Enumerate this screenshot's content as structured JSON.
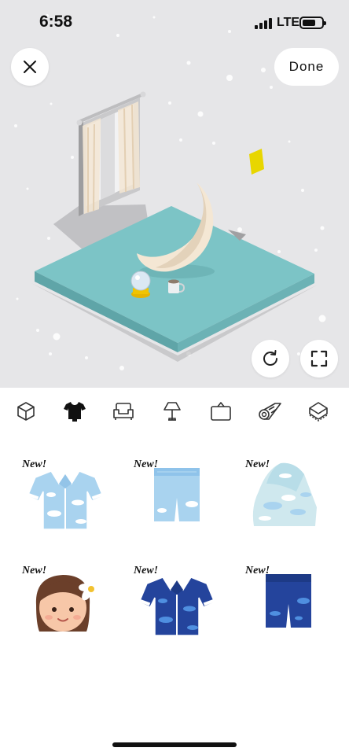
{
  "status": {
    "time": "6:58",
    "network": "LTE"
  },
  "toolbar": {
    "done_label": "Done"
  },
  "categories": [
    {
      "icon": "cube-icon",
      "selected": false
    },
    {
      "icon": "tshirt-icon",
      "selected": true
    },
    {
      "icon": "sofa-icon",
      "selected": false
    },
    {
      "icon": "lamp-icon",
      "selected": false
    },
    {
      "icon": "wall-frame-icon",
      "selected": false
    },
    {
      "icon": "rug-roll-icon",
      "selected": false
    },
    {
      "icon": "floor-tile-icon",
      "selected": false
    }
  ],
  "items": [
    {
      "badge": "New!",
      "name": "cloud-shirt-light"
    },
    {
      "badge": "New!",
      "name": "cloud-shorts-light"
    },
    {
      "badge": "New!",
      "name": "cloud-blanket"
    },
    {
      "badge": "New!",
      "name": "flower-girl-head"
    },
    {
      "badge": "New!",
      "name": "cloud-shirt-dark"
    },
    {
      "badge": "New!",
      "name": "cloud-shorts-dark"
    }
  ],
  "colors": {
    "scene_bg": "#e6e6e8",
    "floor_top": "#7cc4c6",
    "light_blue": "#a9d3ef",
    "navy": "#24449c"
  }
}
